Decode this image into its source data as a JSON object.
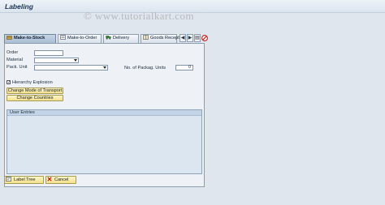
{
  "window": {
    "title": "Labeling",
    "watermark": "© www.tutorialkart.com"
  },
  "tabs": [
    {
      "label": "Make-to-Stock",
      "icon": "stock-icon",
      "active": true
    },
    {
      "label": "Make-to-Order",
      "icon": "order-icon",
      "active": false
    },
    {
      "label": "Delivery",
      "icon": "truck-icon",
      "active": false
    },
    {
      "label": "Goods Recept",
      "icon": "goods-receipt-icon",
      "active": false
    }
  ],
  "tab_nav": {
    "prev_label": "◀",
    "next_label": "▶",
    "list_label": "▤"
  },
  "form": {
    "order_label": "Order",
    "order_value": "",
    "material_label": "Material",
    "material_value": "",
    "pack_unit_label": "Pack. Unit",
    "pack_unit_value": "",
    "packag_units_label": "No. of Packag. Units",
    "packag_units_value": "0",
    "hierarchy_label": "Hierarchy Explosion",
    "hierarchy_checked": true,
    "hierarchy_mark": "✓"
  },
  "buttons": {
    "change_transport": "Change Mode of Transport",
    "change_countries": "Change Countries",
    "label_tree": "Label Tree",
    "cancel": "Cancel"
  },
  "user_entries": {
    "title": "User Entries"
  },
  "colors": {
    "accent_button": "#f2e08c",
    "active_tab": "#a9bdd3"
  }
}
